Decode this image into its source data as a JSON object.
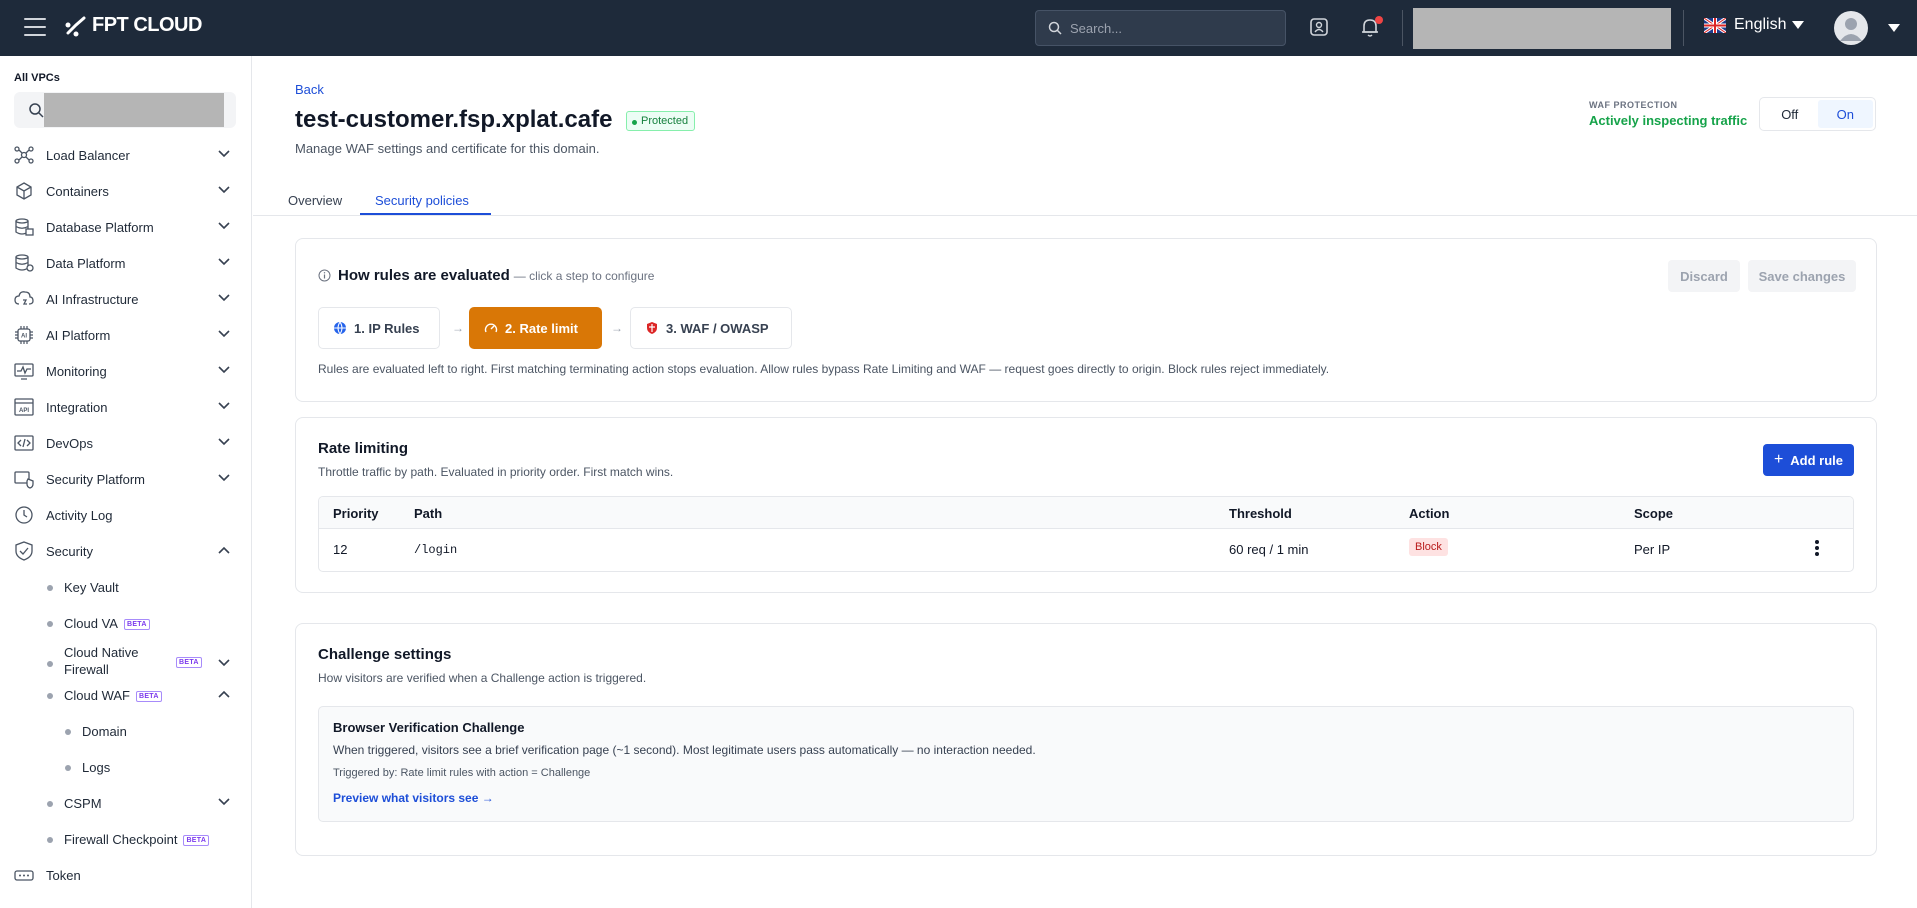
{
  "topbar": {
    "brand": "FPT CLOUD",
    "search_placeholder": "Search...",
    "language": "English"
  },
  "sidebar": {
    "vpc_label": "All VPCs",
    "items": [
      {
        "label": "Load Balancer",
        "icon": "load-balancer-icon"
      },
      {
        "label": "Containers",
        "icon": "containers-icon"
      },
      {
        "label": "Database Platform",
        "icon": "database-icon"
      },
      {
        "label": "Data Platform",
        "icon": "data-platform-icon"
      },
      {
        "label": "AI Infrastructure",
        "icon": "ai-infrastructure-icon"
      },
      {
        "label": "AI Platform",
        "icon": "ai-platform-icon"
      },
      {
        "label": "Monitoring",
        "icon": "monitoring-icon"
      },
      {
        "label": "Integration",
        "icon": "integration-icon"
      },
      {
        "label": "DevOps",
        "icon": "devops-icon"
      },
      {
        "label": "Security Platform",
        "icon": "security-platform-icon"
      },
      {
        "label": "Activity Log",
        "icon": "activity-log-icon"
      },
      {
        "label": "Security",
        "icon": "shield-icon"
      }
    ],
    "security_children": [
      {
        "label": "Key Vault"
      },
      {
        "label": "Cloud VA",
        "beta": "BETA"
      },
      {
        "label": "Cloud Native Firewall",
        "beta": "BETA"
      },
      {
        "label": "Cloud WAF",
        "beta": "BETA"
      },
      {
        "label": "Domain"
      },
      {
        "label": "Logs"
      },
      {
        "label": "CSPM"
      },
      {
        "label": "Firewall Checkpoint",
        "beta": "BETA"
      }
    ],
    "token_label": "Token"
  },
  "header": {
    "back": "Back",
    "domain": "test-customer.fsp.xplat.cafe",
    "status_badge": "Protected",
    "subtitle": "Manage WAF settings and certificate for this domain.",
    "waf_label": "WAF PROTECTION",
    "waf_status": "Actively inspecting traffic",
    "toggle_off": "Off",
    "toggle_on": "On"
  },
  "tabs": [
    {
      "label": "Overview"
    },
    {
      "label": "Security policies",
      "active": true
    }
  ],
  "evaluation": {
    "title": "How rules are evaluated",
    "hint": "— click a step to configure",
    "discard": "Discard",
    "save": "Save changes",
    "steps": [
      {
        "label": "1. IP Rules",
        "icon": "globe-icon"
      },
      {
        "label": "2. Rate limit",
        "icon": "gauge-icon",
        "active": true
      },
      {
        "label": "3. WAF / OWASP",
        "icon": "shield-icon"
      }
    ],
    "note": "Rules are evaluated left to right. First matching terminating action stops evaluation. Allow rules bypass Rate Limiting and WAF — request goes directly to origin. Block rules reject immediately."
  },
  "rate_limiting": {
    "title": "Rate limiting",
    "subtitle": "Throttle traffic by path. Evaluated in priority order. First match wins.",
    "add_button": "Add rule",
    "columns": [
      "Priority",
      "Path",
      "Threshold",
      "Action",
      "Scope"
    ],
    "rows": [
      {
        "priority": "12",
        "path": "/login",
        "threshold": "60 req / 1 min",
        "action": "Block",
        "scope": "Per IP"
      }
    ]
  },
  "challenge": {
    "title": "Challenge settings",
    "subtitle": "How visitors are verified when a Challenge action is triggered.",
    "box_title": "Browser Verification Challenge",
    "box_desc": "When triggered, visitors see a brief verification page (~1 second). Most legitimate users pass automatically — no interaction needed.",
    "box_trigger": "Triggered by: Rate limit rules with action = Challenge",
    "box_link": "Preview what visitors see →"
  },
  "colors": {
    "topbar": "#1e2a3a",
    "accent": "#1d4ed8",
    "active_step": "#d97706",
    "protected": "#16a34a",
    "block": "#b91c1c"
  }
}
